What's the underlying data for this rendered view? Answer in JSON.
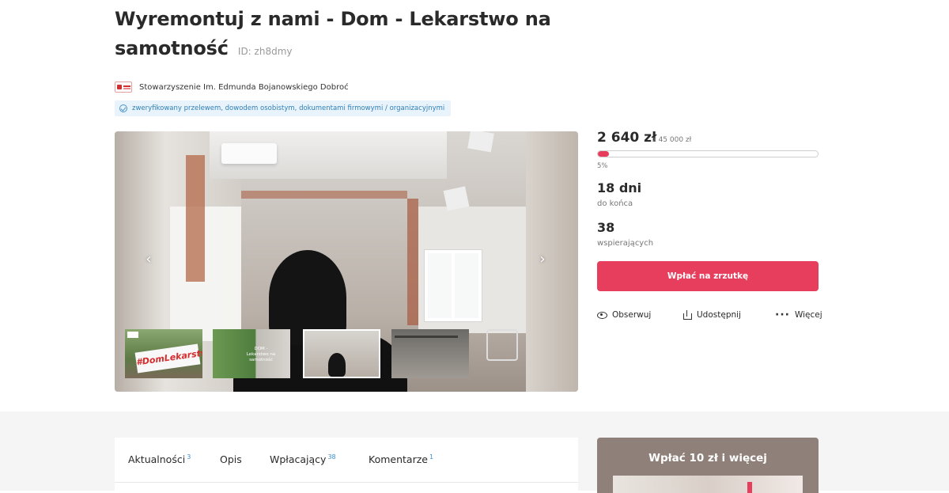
{
  "header": {
    "title": "Wyremontuj z nami - Dom - Lekarstwo na samotność",
    "id_label": "ID: zh8dmy"
  },
  "organizer": {
    "name": "Stowarzyszenie Im. Edmunda Bojanowskiego Dobroć",
    "verified_text": "zweryfikowany przelewem, dowodem osobistym, dokumentami firmowymi / organizacyjnymi"
  },
  "gallery": {
    "thumbnails": [
      {
        "label": "#DomLekarstwo"
      },
      {
        "label": "DOM - Lekarstwo na samotność"
      },
      {
        "label": ""
      },
      {
        "label": ""
      }
    ],
    "active_index": 2
  },
  "fundraiser": {
    "raised": "2 640 zł",
    "goal": "z 45 000 zł",
    "percent_label": "5%",
    "percent": 5,
    "days_num": "18 dni",
    "days_label": "do końca",
    "supporters_num": "38",
    "supporters_label": "wspierających",
    "donate_label": "Wpłać na zrzutkę"
  },
  "actions": {
    "follow": "Obserwuj",
    "share": "Udostępnij",
    "more": "Więcej"
  },
  "tabs": [
    {
      "label": "Aktualności",
      "count": "3"
    },
    {
      "label": "Opis",
      "count": ""
    },
    {
      "label": "Wpłacający",
      "count": "38"
    },
    {
      "label": "Komentarze",
      "count": "1"
    }
  ],
  "promo": {
    "title": "Wpłać 10 zł i więcej"
  },
  "colors": {
    "accent": "#e63e5c",
    "link": "#3d8fd0",
    "verified_bg": "#e9f3fb"
  },
  "icons": [
    "check-circle-icon",
    "eye-icon",
    "share-icon",
    "more-dots-icon",
    "chevron-left-icon",
    "chevron-right-icon"
  ]
}
